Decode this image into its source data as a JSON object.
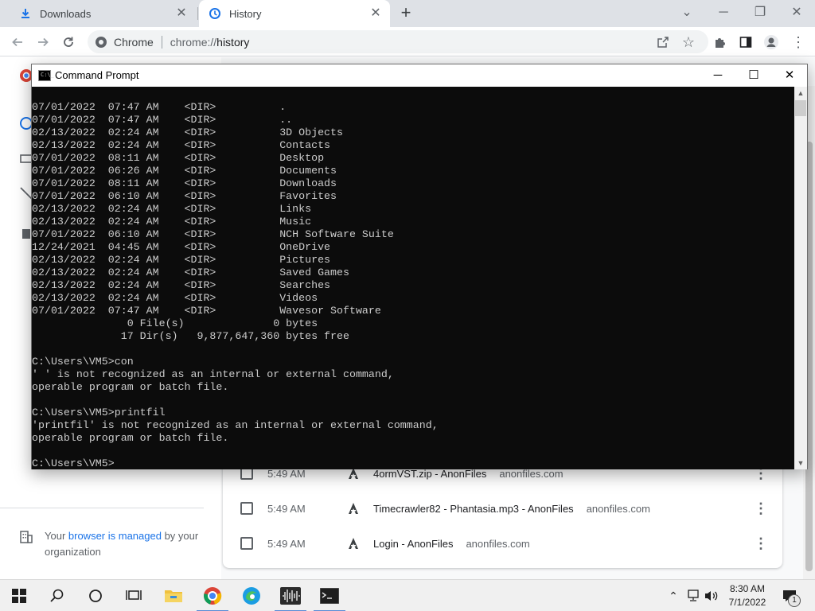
{
  "browser": {
    "tabs": [
      {
        "label": "Downloads",
        "icon": "download-icon",
        "active": false
      },
      {
        "label": "History",
        "icon": "history-icon",
        "active": true
      }
    ],
    "site_label": "Chrome",
    "url_scheme": "chrome://",
    "url_host": "history"
  },
  "history": {
    "managed_prefix": "Your ",
    "managed_link": "browser is managed",
    "managed_suffix": " by your organization",
    "rows": [
      {
        "time": "5:49 AM",
        "title": "4ormVST.zip - AnonFiles",
        "domain": "anonfiles.com"
      },
      {
        "time": "5:49 AM",
        "title": "Timecrawler82 - Phantasia.mp3 - AnonFiles",
        "domain": "anonfiles.com"
      },
      {
        "time": "5:49 AM",
        "title": "Login - AnonFiles",
        "domain": "anonfiles.com"
      }
    ]
  },
  "cmd": {
    "title": "Command Prompt",
    "lines": [
      "07/01/2022  07:47 AM    <DIR>          .",
      "07/01/2022  07:47 AM    <DIR>          ..",
      "02/13/2022  02:24 AM    <DIR>          3D Objects",
      "02/13/2022  02:24 AM    <DIR>          Contacts",
      "07/01/2022  08:11 AM    <DIR>          Desktop",
      "07/01/2022  06:26 AM    <DIR>          Documents",
      "07/01/2022  08:11 AM    <DIR>          Downloads",
      "07/01/2022  06:10 AM    <DIR>          Favorites",
      "02/13/2022  02:24 AM    <DIR>          Links",
      "02/13/2022  02:24 AM    <DIR>          Music",
      "07/01/2022  06:10 AM    <DIR>          NCH Software Suite",
      "12/24/2021  04:45 AM    <DIR>          OneDrive",
      "02/13/2022  02:24 AM    <DIR>          Pictures",
      "02/13/2022  02:24 AM    <DIR>          Saved Games",
      "02/13/2022  02:24 AM    <DIR>          Searches",
      "02/13/2022  02:24 AM    <DIR>          Videos",
      "07/01/2022  07:47 AM    <DIR>          Wavesor Software",
      "               0 File(s)              0 bytes",
      "              17 Dir(s)   9,877,647,360 bytes free",
      "",
      "C:\\Users\\VM5>con",
      "' ' is not recognized as an internal or external command,",
      "operable program or batch file.",
      "",
      "C:\\Users\\VM5>printfil",
      "'printfil' is not recognized as an internal or external command,",
      "operable program or batch file.",
      "",
      "C:\\Users\\VM5>"
    ]
  },
  "taskbar": {
    "time": "8:30 AM",
    "date": "7/1/2022",
    "notification_count": "1"
  }
}
